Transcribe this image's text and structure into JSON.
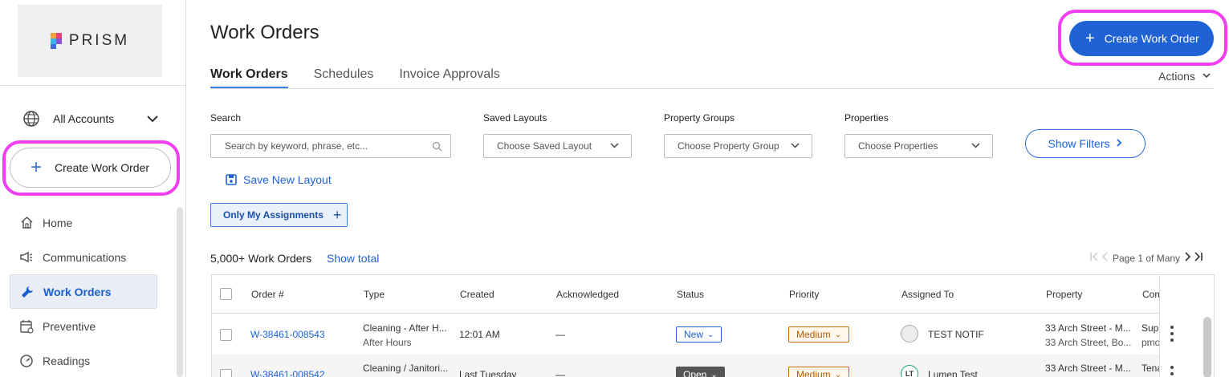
{
  "brand": {
    "logo_text": "PRISM"
  },
  "sidebar": {
    "account_selector": {
      "label": "All Accounts"
    },
    "create_button": {
      "label": "Create Work Order"
    },
    "items": [
      {
        "label": "Home",
        "icon": "home-icon"
      },
      {
        "label": "Communications",
        "icon": "megaphone-icon"
      },
      {
        "label": "Work Orders",
        "icon": "wrench-icon",
        "active": true
      },
      {
        "label": "Preventive",
        "icon": "calendar-icon"
      },
      {
        "label": "Readings",
        "icon": "gauge-icon"
      }
    ]
  },
  "header": {
    "title": "Work Orders",
    "create_button": "Create Work Order",
    "actions_label": "Actions",
    "tabs": [
      {
        "label": "Work Orders",
        "active": true
      },
      {
        "label": "Schedules"
      },
      {
        "label": "Invoice Approvals"
      }
    ]
  },
  "filters": {
    "search": {
      "label": "Search",
      "placeholder": "Search by keyword, phrase, etc..."
    },
    "saved_layouts": {
      "label": "Saved Layouts",
      "value": "Choose Saved Layout"
    },
    "property_groups": {
      "label": "Property Groups",
      "value": "Choose Property Group"
    },
    "properties": {
      "label": "Properties",
      "value": "Choose Properties"
    },
    "show_filters": "Show Filters",
    "save_layout": "Save New Layout",
    "only_my_assignments": "Only My Assignments"
  },
  "results": {
    "count": "5,000+ Work Orders",
    "show_total": "Show total",
    "pagination": "Page 1 of Many"
  },
  "table": {
    "columns": [
      "Order #",
      "Type",
      "Created",
      "Acknowledged",
      "Status",
      "Priority",
      "Assigned To",
      "Property",
      "Com"
    ],
    "rows": [
      {
        "order": "W-38461-008543",
        "type": "Cleaning - After H...",
        "type_sub": "After Hours",
        "created": "12:01 AM",
        "acknowledged": "—",
        "status": "New",
        "priority": "Medium",
        "assigned_initials": "",
        "assigned": "TEST NOTIF",
        "property": "33 Arch Street - M...",
        "property_sub": "33 Arch Street, Bo...",
        "comment": "Supp",
        "comment_sub": "pmo"
      },
      {
        "order": "W-38461-008542",
        "type": "Cleaning / Janitori...",
        "type_sub": "",
        "created": "Last Tuesday",
        "acknowledged": "—",
        "status": "Open",
        "priority": "Medium",
        "assigned_initials": "LT",
        "assigned": "Lumen Test",
        "property": "33 Arch Street - M...",
        "property_sub": "",
        "comment": "Tena",
        "comment_sub": ""
      }
    ]
  },
  "colors": {
    "primary": "#1e62d6",
    "highlight": "#f03ef0",
    "medium_priority": "#c56a00",
    "open_status": "#555555"
  }
}
